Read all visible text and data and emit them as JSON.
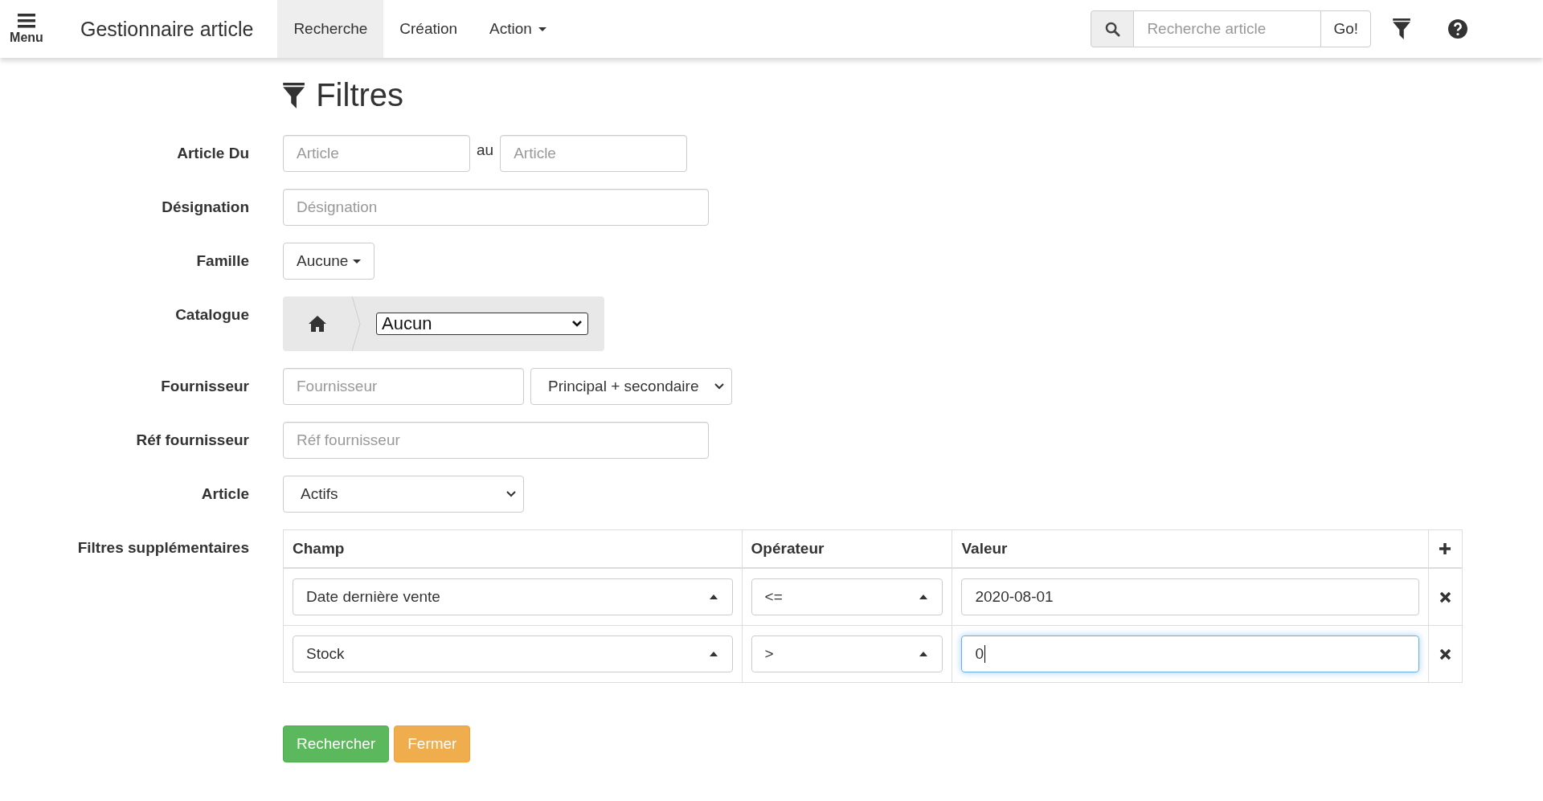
{
  "navbar": {
    "menu_label": "Menu",
    "brand": "Gestionnaire article",
    "tabs": [
      {
        "label": "Recherche",
        "selected": true,
        "kind": "link"
      },
      {
        "label": "Création",
        "selected": false,
        "kind": "link"
      },
      {
        "label": "Action",
        "selected": false,
        "kind": "dropdown"
      }
    ],
    "search": {
      "placeholder": "Recherche article",
      "button": "Go!"
    }
  },
  "title": "Filtres",
  "fields": [
    {
      "kind": "range",
      "label": "Article Du",
      "from_placeholder": "Article",
      "separator": "au",
      "to_placeholder": "Article"
    },
    {
      "kind": "text",
      "label": "Désignation",
      "placeholder": "Désignation"
    },
    {
      "kind": "dropdown",
      "label": "Famille",
      "value": "Aucune"
    },
    {
      "kind": "catalogue",
      "label": "Catalogue",
      "value": "Aucun"
    },
    {
      "kind": "text_select",
      "label": "Fournisseur",
      "placeholder": "Fournisseur",
      "select_value": "Principal + secondaire"
    },
    {
      "kind": "text",
      "label": "Réf fournisseur",
      "placeholder": "Réf fournisseur"
    },
    {
      "kind": "select",
      "label": "Article",
      "value": "Actifs"
    }
  ],
  "extra_filters": {
    "label": "Filtres supplémentaires",
    "columns": [
      "Champ",
      "Opérateur",
      "Valeur"
    ],
    "rows": [
      {
        "field": "Date dernière vente",
        "operator": "<=",
        "value": "2020-08-01",
        "focused": false
      },
      {
        "field": "Stock",
        "operator": ">",
        "value": "0",
        "focused": true
      }
    ]
  },
  "buttons": [
    {
      "label": "Rechercher",
      "kind": "success"
    },
    {
      "label": "Fermer",
      "kind": "warning"
    }
  ]
}
